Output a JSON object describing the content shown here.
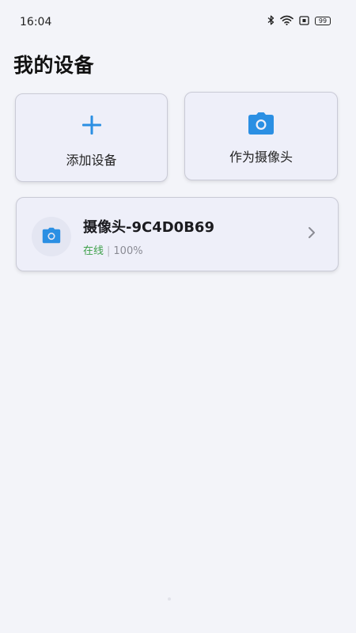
{
  "status_bar": {
    "time": "16:04",
    "battery_level": "99",
    "icons": [
      "bluetooth-icon",
      "wifi-icon",
      "notification-icon",
      "battery-icon"
    ]
  },
  "header": {
    "title": "我的设备"
  },
  "actions": {
    "add_device_label": "添加设备",
    "use_as_camera_label": "作为摄像头"
  },
  "devices": [
    {
      "name": "摄像头-9C4D0B69",
      "status": "在线",
      "separator": "|",
      "battery": "100%",
      "icon": "camera-icon"
    }
  ],
  "colors": {
    "accent": "#2b8fe3",
    "online": "#3fa14b",
    "background": "#f3f4f9",
    "card": "#eeeff9"
  }
}
